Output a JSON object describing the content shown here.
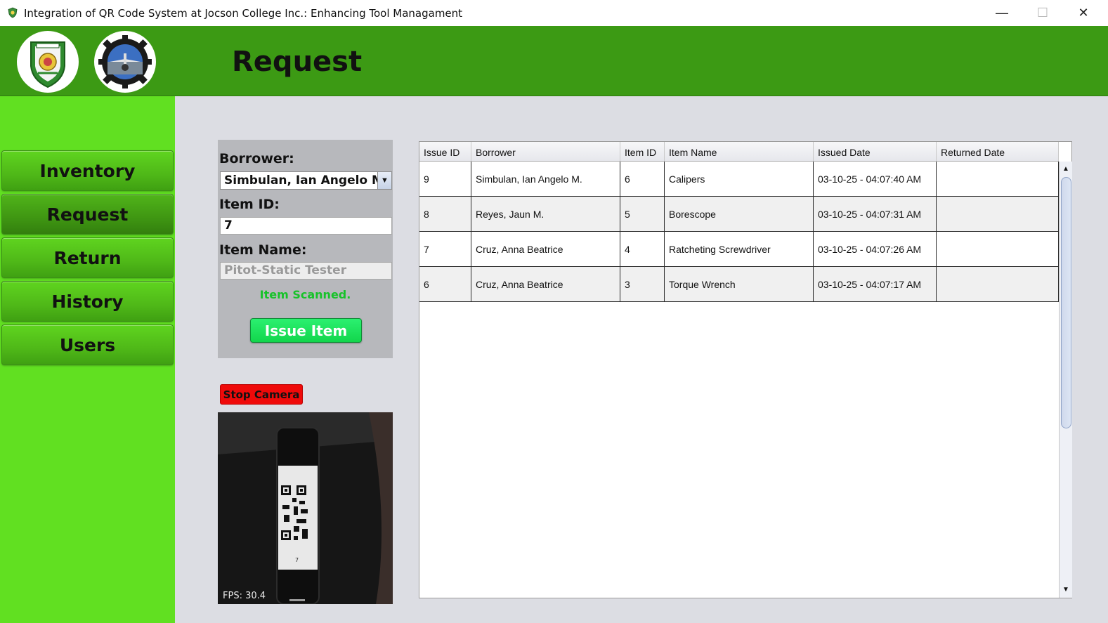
{
  "window": {
    "title": "Integration of QR Code System at Jocson College Inc.: Enhancing Tool Managament",
    "minimize": "—",
    "maximize": "☐",
    "close": "✕"
  },
  "header": {
    "page_title": "Request"
  },
  "sidebar": {
    "items": [
      {
        "label": "Inventory"
      },
      {
        "label": "Request"
      },
      {
        "label": "Return"
      },
      {
        "label": "History"
      },
      {
        "label": "Users"
      }
    ],
    "active": "Request"
  },
  "form": {
    "borrower_label": "Borrower:",
    "borrower_value": "Simbulan, Ian Angelo M.",
    "item_id_label": "Item ID:",
    "item_id_value": "7",
    "item_name_label": "Item Name:",
    "item_name_value": "Pitot-Static Tester",
    "status": "Item Scanned.",
    "issue_button": "Issue Item"
  },
  "camera": {
    "stop_button": "Stop Camera",
    "fps": "FPS: 30.4",
    "qr_label": "7"
  },
  "table": {
    "columns": [
      "Issue ID",
      "Borrower",
      "Item ID",
      "Item Name",
      "Issued Date",
      "Returned Date"
    ],
    "rows": [
      [
        "9",
        "Simbulan, Ian Angelo M.",
        "6",
        "Calipers",
        "03-10-25 - 04:07:40 AM",
        ""
      ],
      [
        "8",
        "Reyes, Jaun M.",
        "5",
        "Borescope",
        "03-10-25 - 04:07:31 AM",
        ""
      ],
      [
        "7",
        "Cruz, Anna Beatrice",
        "4",
        "Ratcheting Screwdriver",
        "03-10-25 - 04:07:26 AM",
        ""
      ],
      [
        "6",
        "Cruz, Anna Beatrice",
        "3",
        "Torque Wrench",
        "03-10-25 - 04:07:17 AM",
        ""
      ]
    ]
  },
  "colors": {
    "header_green": "#3c9a14",
    "sidebar_green": "#61e021",
    "status_green": "#18c22a",
    "stop_red": "#ef0a0a"
  }
}
